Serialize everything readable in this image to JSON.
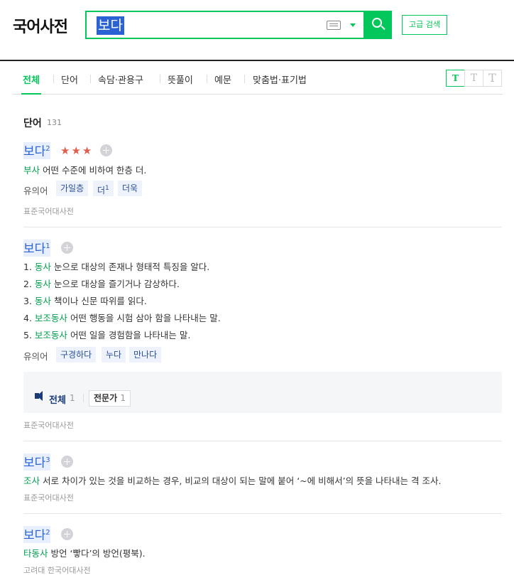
{
  "header": {
    "logo": "국어사전",
    "search": {
      "value": "보다",
      "placeholder": ""
    },
    "advanced_search": "고급 검색"
  },
  "tabs": [
    "전체",
    "단어",
    "속담·관용구",
    "뜻풀이",
    "예문",
    "맞춤법·표기법"
  ],
  "font_size_buttons": [
    "T",
    "T",
    "T"
  ],
  "section": {
    "title": "단어",
    "count": "131"
  },
  "entries": [
    {
      "headword": "보다",
      "sup": "2",
      "stars": "★★★",
      "defs": [
        {
          "pos": "부사",
          "text": "어떤 수준에 비하여 한층 더."
        }
      ],
      "syn_label": "유의어",
      "synonyms": [
        {
          "word": "가일층",
          "sup": ""
        },
        {
          "word": "더",
          "sup": "1"
        },
        {
          "word": "더욱",
          "sup": ""
        }
      ],
      "source": "표준국어대사전"
    },
    {
      "headword": "보다",
      "sup": "1",
      "defs": [
        {
          "num": "1.",
          "pos": "동사",
          "text": "눈으로 대상의 존재나 형태적 특징을 알다."
        },
        {
          "num": "2.",
          "pos": "동사",
          "text": "눈으로 대상을 즐기거나 감상하다."
        },
        {
          "num": "3.",
          "pos": "동사",
          "text": "책이나 신문 따위를 읽다."
        },
        {
          "num": "4.",
          "pos": "보조동사",
          "text": "어떤 행동을 시험 삼아 함을 나타내는 말."
        },
        {
          "num": "5.",
          "pos": "보조동사",
          "text": "어떤 일을 경험함을 나타내는 말."
        }
      ],
      "syn_label": "유의어",
      "synonyms": [
        {
          "word": "구경하다"
        },
        {
          "word": "누다"
        },
        {
          "word": "만나다"
        }
      ],
      "examples": {
        "all_label": "전체",
        "all_count": "1",
        "expert_label": "전문가",
        "expert_count": "1"
      },
      "source": "표준국어대사전"
    },
    {
      "headword": "보다",
      "sup": "3",
      "defs": [
        {
          "pos": "조사",
          "text": "서로 차이가 있는 것을 비교하는 경우, 비교의 대상이 되는 말에 붙어 ‘~에 비해서’의 뜻을 나타내는 격 조사."
        }
      ],
      "source": "표준국어대사전"
    },
    {
      "headword": "보다",
      "sup": "2",
      "defs": [
        {
          "pos": "타동사",
          "text": "방언 ‘빻다’의 방언(평북)."
        }
      ],
      "source": "고려대 한국어대사전"
    }
  ],
  "colors": {
    "accent": "#03c75a",
    "headword": "#2a62d3",
    "pos": "#03a04f",
    "star": "#e05c4b"
  }
}
